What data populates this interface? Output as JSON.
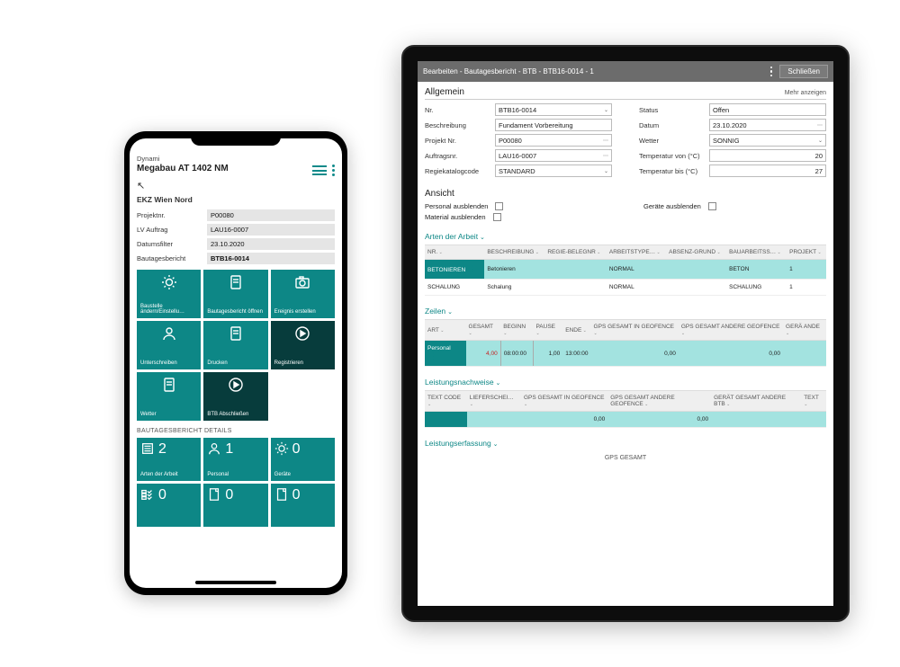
{
  "phone": {
    "app_header": "Dynami",
    "title": "Megabau AT 1402 NM",
    "site_name": "EKZ Wien Nord",
    "fields": {
      "projektnr_label": "Projektnr.",
      "projektnr": "P00080",
      "lv_auftrag_label": "LV Auftrag",
      "lv_auftrag": "LAU16-0007",
      "datumsfilter_label": "Datumsfilter",
      "datumsfilter": "23.10.2020",
      "bautagesbericht_label": "Bautagesbericht",
      "bautagesbericht": "BTB16-0014"
    },
    "tiles": [
      {
        "label": "Baustelle ändern/Einstellu…",
        "icon": "gear"
      },
      {
        "label": "Bautagesbericht öffnen",
        "icon": "doc"
      },
      {
        "label": "Ereignis erstellen",
        "icon": "camera"
      },
      {
        "label": "Unterschreiben",
        "icon": "person"
      },
      {
        "label": "Drucken",
        "icon": "doc"
      },
      {
        "label": "Registrieren",
        "icon": "play",
        "dark": true
      },
      {
        "label": "Wetter",
        "icon": "doc"
      },
      {
        "label": "BTB Abschließen",
        "icon": "play",
        "dark": true
      }
    ],
    "details_header": "BAUTAGESBERICHT DETAILS",
    "detail_tiles": [
      {
        "label": "Arten der Arbeit",
        "count": "2",
        "icon": "list"
      },
      {
        "label": "Personal",
        "count": "1",
        "icon": "person"
      },
      {
        "label": "Geräte",
        "count": "0",
        "icon": "gear"
      },
      {
        "label": "",
        "count": "0",
        "icon": "check"
      },
      {
        "label": "",
        "count": "0",
        "icon": "page"
      },
      {
        "label": "",
        "count": "0",
        "icon": "page"
      }
    ]
  },
  "tablet": {
    "header_title": "Bearbeiten - Bautagesbericht - BTB - BTB16-0014 - 1",
    "close_label": "Schließen",
    "more_label": "Mehr anzeigen",
    "sections": {
      "allgemein": "Allgemein",
      "ansicht": "Ansicht",
      "arten": "Arten der Arbeit",
      "zeilen": "Zeilen",
      "leistungsnachweise": "Leistungsnachweise",
      "leistungserfassung": "Leistungserfassung"
    },
    "form": {
      "nr_label": "Nr.",
      "nr": "BTB16-0014",
      "beschreibung_label": "Beschreibung",
      "beschreibung": "Fundament Vorbereitung",
      "projektnr_label": "Projekt Nr.",
      "projektnr": "P00080",
      "auftragsnr_label": "Auftragsnr.",
      "auftragsnr": "LAU16-0007",
      "regiekatalog_label": "Regiekatalogcode",
      "regiekatalog": "STANDARD",
      "status_label": "Status",
      "status": "Offen",
      "datum_label": "Datum",
      "datum": "23.10.2020",
      "wetter_label": "Wetter",
      "wetter": "SONNIG",
      "temp_von_label": "Temperatur von (°C)",
      "temp_von": "20",
      "temp_bis_label": "Temperatur bis (°C)",
      "temp_bis": "27"
    },
    "ansicht": {
      "personal_label": "Personal ausblenden",
      "material_label": "Material ausblenden",
      "geraete_label": "Geräte ausblenden"
    },
    "arten_headers": [
      "NR.",
      "BESCHREIBUNG",
      "REGIE-BELEGNR",
      "ARBEITSTYPE…",
      "ABSENZ-GRUND",
      "BAUARBEITSS…",
      "PROJEKT"
    ],
    "arten_rows": [
      {
        "nr": "BETONIEREN",
        "beschreibung": "Betonieren",
        "regie": "",
        "typ": "NORMAL",
        "absenz": "",
        "bau": "BETON",
        "proj": "1"
      },
      {
        "nr": "SCHALUNG",
        "beschreibung": "Schalung",
        "regie": "",
        "typ": "NORMAL",
        "absenz": "",
        "bau": "SCHALUNG",
        "proj": "1"
      }
    ],
    "zeilen_headers": [
      "ART",
      "GESAMT",
      "BEGINN",
      "PAUSE",
      "ENDE",
      "GPS GESAMT IN GEOFENCE",
      "GPS GESAMT ANDERE GEOFENCE",
      "GERÄ ANDE"
    ],
    "zeilen_row": {
      "art": "Personal",
      "gesamt": "4,00",
      "beginn": "08:00:00",
      "pause": "1,00",
      "ende": "13:00:00",
      "gps1": "0,00",
      "gps2": "0,00"
    },
    "ln_headers": [
      "TEXT CODE",
      "LIEFERSCHEI…",
      "GPS GESAMT IN GEOFENCE",
      "GPS GESAMT ANDERE GEOFENCE",
      "GERÄT GESAMT ANDERE BTB",
      "TEXT"
    ],
    "ln_row": {
      "gps1": "0,00",
      "gps2": "0,00"
    },
    "gps_label": "GPS GESAMT"
  }
}
